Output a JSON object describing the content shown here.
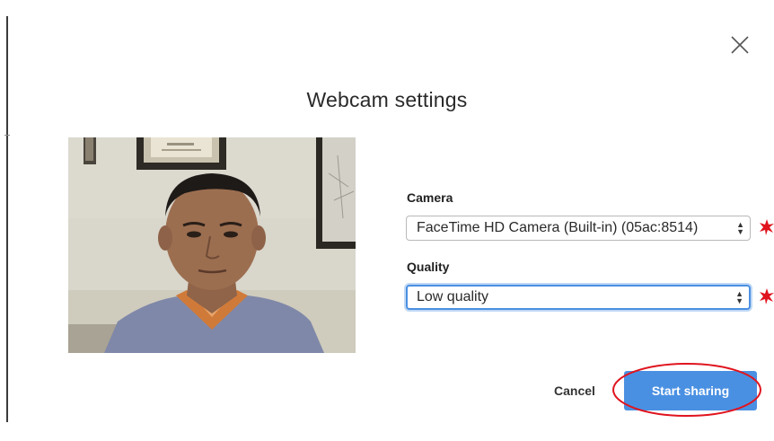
{
  "dialog": {
    "title": "Webcam settings",
    "close_icon": "close-icon"
  },
  "preview": {
    "icon": "webcam-preview-image"
  },
  "camera": {
    "label": "Camera",
    "selected": "FaceTime HD Camera (Built-in) (05ac:8514)"
  },
  "quality": {
    "label": "Quality",
    "selected": "Low quality"
  },
  "actions": {
    "cancel_label": "Cancel",
    "start_label": "Start sharing"
  },
  "colors": {
    "primary_button": "#4a90e2",
    "annotation_red": "#e0141e",
    "focus_ring": "#4a90e2"
  },
  "annotations": {
    "markers": [
      "red-star-marker",
      "red-star-marker",
      "red-ellipse-highlight"
    ]
  }
}
